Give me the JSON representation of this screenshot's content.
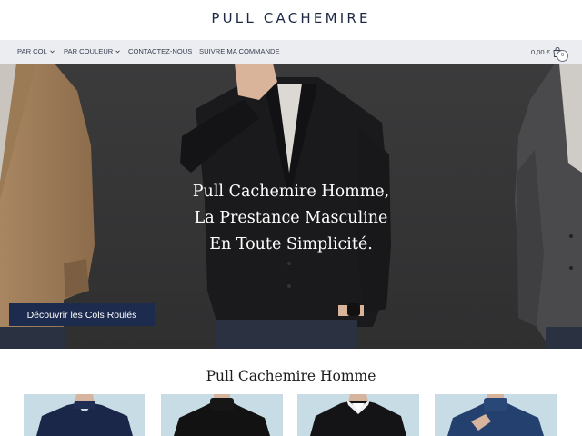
{
  "header": {
    "logo": "PULL CACHEMIRE"
  },
  "nav": {
    "items": [
      {
        "label": "PAR COL",
        "dropdown": true
      },
      {
        "label": "PAR COULEUR",
        "dropdown": true
      },
      {
        "label": "CONTACTEZ-NOUS",
        "dropdown": false
      },
      {
        "label": "SUIVRE MA COMMANDE",
        "dropdown": false
      }
    ],
    "cart": {
      "total": "0,00 €",
      "count": "0",
      "icon": "shopping-bag-icon"
    }
  },
  "hero": {
    "title_lines": [
      "Pull Cachemire Homme,",
      "La Prestance Masculine",
      "En Toute Simplicité."
    ],
    "cta_label": "Découvrir les Cols Roulés"
  },
  "products_section": {
    "title": "Pull Cachemire Homme",
    "products": [
      {
        "name": "navy-mock-neck-sweater"
      },
      {
        "name": "black-turtleneck-sweater"
      },
      {
        "name": "black-crew-neck-sweater-with-collar"
      },
      {
        "name": "blue-turtleneck-sweater"
      }
    ]
  },
  "colors": {
    "brand_navy": "#1d2b4f",
    "nav_bg": "#ebedf1",
    "hero_bg": "#3a3a3b",
    "product_bg": "#c9dde6"
  }
}
